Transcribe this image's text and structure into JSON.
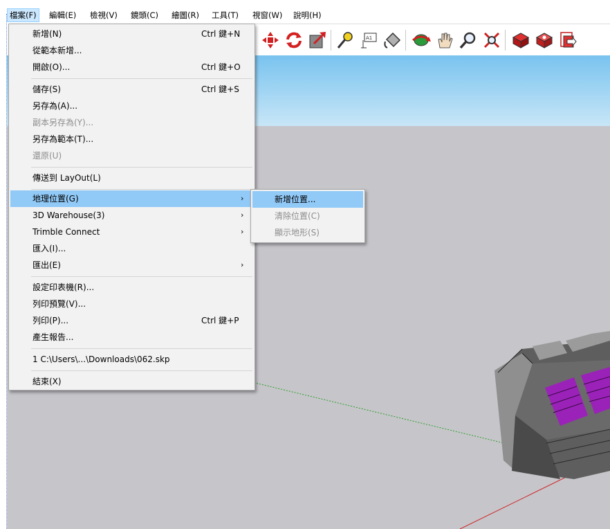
{
  "menubar": {
    "items": [
      {
        "label": "檔案(F)"
      },
      {
        "label": "編輯(E)"
      },
      {
        "label": "檢視(V)"
      },
      {
        "label": "鏡頭(C)"
      },
      {
        "label": "繪圖(R)"
      },
      {
        "label": "工具(T)"
      },
      {
        "label": "視窗(W)"
      },
      {
        "label": "說明(H)"
      }
    ]
  },
  "file_menu": {
    "items": [
      {
        "label": "新增(N)",
        "shortcut": "Ctrl 鍵+N"
      },
      {
        "label": "從範本新增..."
      },
      {
        "label": "開啟(O)...",
        "shortcut": "Ctrl 鍵+O"
      },
      {
        "label": "儲存(S)",
        "shortcut": "Ctrl 鍵+S"
      },
      {
        "label": "另存為(A)..."
      },
      {
        "label": "副本另存為(Y)..."
      },
      {
        "label": "另存為範本(T)..."
      },
      {
        "label": "還原(U)"
      },
      {
        "label": "傳送到 LayOut(L)"
      },
      {
        "label": "地理位置(G)",
        "arrow": "›"
      },
      {
        "label": "3D Warehouse(3)",
        "arrow": "›"
      },
      {
        "label": "Trimble Connect",
        "arrow": "›"
      },
      {
        "label": "匯入(I)..."
      },
      {
        "label": "匯出(E)",
        "arrow": "›"
      },
      {
        "label": "設定印表機(R)..."
      },
      {
        "label": "列印預覽(V)..."
      },
      {
        "label": "列印(P)...",
        "shortcut": "Ctrl 鍵+P"
      },
      {
        "label": "產生報告..."
      },
      {
        "label": "1 C:\\Users\\...\\Downloads\\062.skp"
      },
      {
        "label": "結束(X)"
      }
    ]
  },
  "geo_submenu": {
    "items": [
      {
        "label": "新增位置..."
      },
      {
        "label": "清除位置(C)"
      },
      {
        "label": "顯示地形(S)"
      }
    ]
  },
  "toolbar": {
    "icons": [
      "move-icon",
      "rotate-icon",
      "scale-icon",
      "tape-measure-icon",
      "text-icon",
      "paint-bucket-icon",
      "orbit-icon",
      "pan-icon",
      "zoom-icon",
      "zoom-extents-icon",
      "3d-warehouse-icon",
      "extension-warehouse-icon",
      "send-to-layout-icon"
    ]
  },
  "colors": {
    "menu_highlight": "#91c9f7",
    "menubar_active": "#cce8ff",
    "sky": "#79c3ef",
    "ground": "#c6c5ca",
    "model_gray": "#6f6f6f",
    "model_purple": "#9b22b8"
  }
}
